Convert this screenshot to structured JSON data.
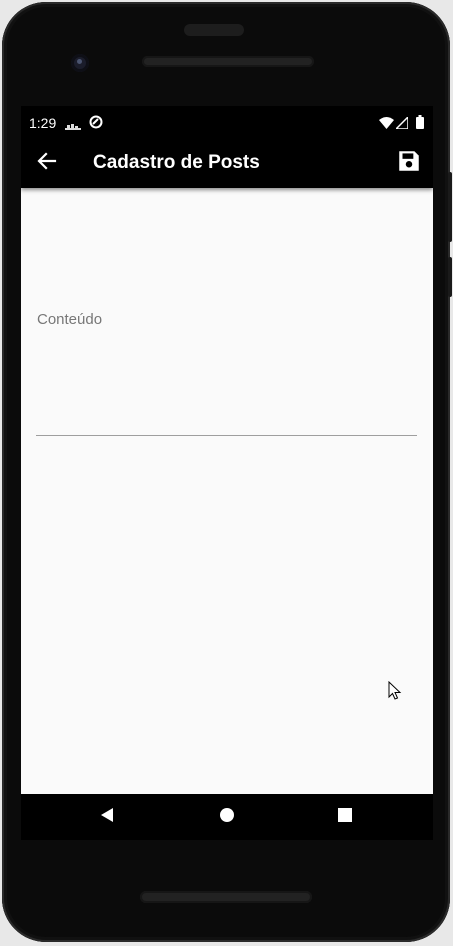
{
  "status_bar": {
    "time": "1:29",
    "icons": [
      "notification-icon",
      "sync-icon",
      "wifi-icon",
      "cell-signal-icon",
      "battery-icon"
    ]
  },
  "app_bar": {
    "title": "Cadastro de Posts",
    "back_icon": "arrow-back-icon",
    "save_icon": "save-icon"
  },
  "form": {
    "content_field": {
      "label": "Conteúdo",
      "value": ""
    }
  },
  "navigation_bar": {
    "buttons": [
      "back-triangle-icon",
      "home-circle-icon",
      "recents-square-icon"
    ]
  },
  "colors": {
    "app_bar": "#000000",
    "body": "#fafafa",
    "label": "#777777",
    "underline": "#9e9e9e"
  }
}
